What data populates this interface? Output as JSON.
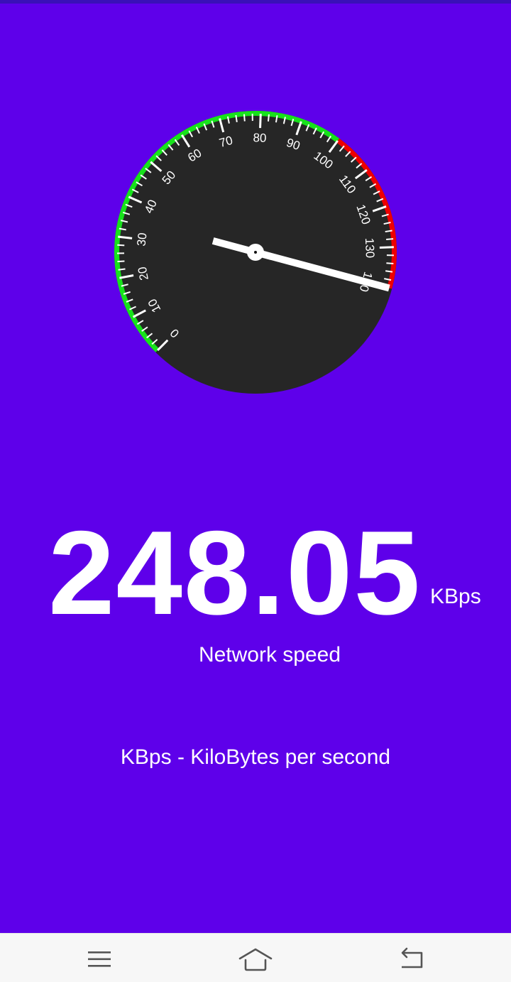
{
  "gauge": {
    "min": 0,
    "max": 140,
    "major_step": 10,
    "minor_step": 2,
    "tick_labels": [
      "0",
      "10",
      "20",
      "30",
      "40",
      "50",
      "60",
      "70",
      "80",
      "90",
      "100",
      "110",
      "120",
      "130",
      "140"
    ],
    "green_range": [
      0,
      100
    ],
    "red_range": [
      100,
      140
    ],
    "needle_value": 140,
    "colors": {
      "dial_face": "#262626",
      "green_zone": "#17e21b",
      "red_zone": "#ee0000",
      "ticks": "#ffffff",
      "needle": "#ffffff"
    }
  },
  "reading": {
    "value": "248.05",
    "unit": "KBps",
    "caption": "Network speed"
  },
  "footer_note": "KBps - KiloBytes per second",
  "theme": {
    "background": "#5e00ea",
    "nav_bar": "#f7f7f7"
  },
  "nav": {
    "items": [
      {
        "icon": "menu-icon"
      },
      {
        "icon": "home-icon"
      },
      {
        "icon": "back-icon"
      }
    ]
  }
}
